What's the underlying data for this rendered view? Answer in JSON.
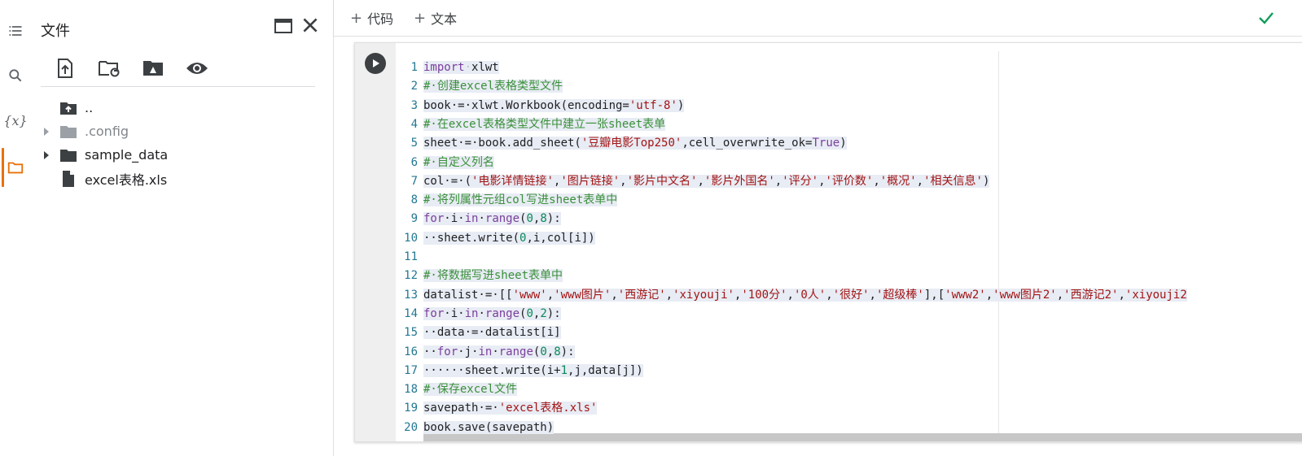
{
  "colors": {
    "accent_orange": "#e8710a",
    "check_green": "#0f9d58",
    "keyword": "#7a3e9d",
    "comment": "#3a8f3a",
    "string": "#a31515",
    "number": "#09885a",
    "line_number": "#237893"
  },
  "rail": {
    "items": [
      {
        "icon": "list-icon"
      },
      {
        "icon": "search-icon"
      },
      {
        "icon": "variables-icon",
        "label": "{x}"
      },
      {
        "icon": "folder-icon",
        "active": true
      }
    ]
  },
  "panel": {
    "title": "文件",
    "tools": [
      "upload-icon",
      "refresh-folder-icon",
      "drive-icon",
      "eye-icon"
    ],
    "tree": [
      {
        "name": "..",
        "type": "parent",
        "caret": false
      },
      {
        "name": ".config",
        "type": "folder",
        "caret": true,
        "muted": true
      },
      {
        "name": "sample_data",
        "type": "folder",
        "caret": true
      },
      {
        "name": "excel表格.xls",
        "type": "file",
        "caret": false
      }
    ]
  },
  "topbar": {
    "add_code": "代码",
    "add_text": "文本"
  },
  "code_lines": [
    {
      "n": "1",
      "segs": [
        [
          "k",
          "import"
        ],
        [
          "p",
          "·"
        ],
        [
          "t",
          "xlwt"
        ]
      ]
    },
    {
      "n": "2",
      "segs": [
        [
          "c",
          "#·创建excel表格类型文件"
        ]
      ]
    },
    {
      "n": "3",
      "segs": [
        [
          "t",
          "book·=·xlwt.Workbook(encoding="
        ],
        [
          "s",
          "'utf-8'"
        ],
        [
          "t",
          ")"
        ]
      ]
    },
    {
      "n": "4",
      "segs": [
        [
          "c",
          "#·在excel表格类型文件中建立一张sheet表单"
        ]
      ]
    },
    {
      "n": "5",
      "segs": [
        [
          "t",
          "sheet·=·book.add_sheet("
        ],
        [
          "s",
          "'豆瓣电影Top250'"
        ],
        [
          "t",
          ",cell_overwrite_ok="
        ],
        [
          "k",
          "True"
        ],
        [
          "t",
          ")"
        ]
      ]
    },
    {
      "n": "6",
      "segs": [
        [
          "c",
          "#·自定义列名"
        ]
      ]
    },
    {
      "n": "7",
      "segs": [
        [
          "t",
          "col·=·("
        ],
        [
          "s",
          "'电影详情链接'"
        ],
        [
          "t",
          ","
        ],
        [
          "s",
          "'图片链接'"
        ],
        [
          "t",
          ","
        ],
        [
          "s",
          "'影片中文名'"
        ],
        [
          "t",
          ","
        ],
        [
          "s",
          "'影片外国名'"
        ],
        [
          "t",
          ","
        ],
        [
          "s",
          "'评分'"
        ],
        [
          "t",
          ","
        ],
        [
          "s",
          "'评价数'"
        ],
        [
          "t",
          ","
        ],
        [
          "s",
          "'概况'"
        ],
        [
          "t",
          ","
        ],
        [
          "s",
          "'相关信息'"
        ],
        [
          "t",
          ")"
        ]
      ]
    },
    {
      "n": "8",
      "segs": [
        [
          "c",
          "#·将列属性元组col写进sheet表单中"
        ]
      ]
    },
    {
      "n": "9",
      "segs": [
        [
          "k",
          "for"
        ],
        [
          "t",
          "·i·"
        ],
        [
          "k",
          "in"
        ],
        [
          "t",
          "·"
        ],
        [
          "k",
          "range"
        ],
        [
          "t",
          "("
        ],
        [
          "m",
          "0"
        ],
        [
          "t",
          ","
        ],
        [
          "m",
          "8"
        ],
        [
          "t",
          "):"
        ]
      ]
    },
    {
      "n": "10",
      "segs": [
        [
          "t",
          "··sheet.write("
        ],
        [
          "m",
          "0"
        ],
        [
          "t",
          ",i,col[i])"
        ]
      ]
    },
    {
      "n": "11",
      "segs": []
    },
    {
      "n": "12",
      "segs": [
        [
          "c",
          "#·将数据写进sheet表单中"
        ]
      ]
    },
    {
      "n": "13",
      "segs": [
        [
          "t",
          "datalist·=·[["
        ],
        [
          "s",
          "'www'"
        ],
        [
          "t",
          ","
        ],
        [
          "s",
          "'www图片'"
        ],
        [
          "t",
          ","
        ],
        [
          "s",
          "'西游记'"
        ],
        [
          "t",
          ","
        ],
        [
          "s",
          "'xiyouji'"
        ],
        [
          "t",
          ","
        ],
        [
          "s",
          "'100分'"
        ],
        [
          "t",
          ","
        ],
        [
          "s",
          "'0人'"
        ],
        [
          "t",
          ","
        ],
        [
          "s",
          "'很好'"
        ],
        [
          "t",
          ","
        ],
        [
          "s",
          "'超级棒'"
        ],
        [
          "t",
          "],["
        ],
        [
          "s",
          "'www2'"
        ],
        [
          "t",
          ","
        ],
        [
          "s",
          "'www图片2'"
        ],
        [
          "t",
          ","
        ],
        [
          "s",
          "'西游记2'"
        ],
        [
          "t",
          ","
        ],
        [
          "s",
          "'xiyouji2"
        ]
      ]
    },
    {
      "n": "14",
      "segs": [
        [
          "k",
          "for"
        ],
        [
          "t",
          "·i·"
        ],
        [
          "k",
          "in"
        ],
        [
          "t",
          "·"
        ],
        [
          "k",
          "range"
        ],
        [
          "t",
          "("
        ],
        [
          "m",
          "0"
        ],
        [
          "t",
          ","
        ],
        [
          "m",
          "2"
        ],
        [
          "t",
          "):"
        ]
      ]
    },
    {
      "n": "15",
      "segs": [
        [
          "t",
          "··data·=·datalist[i]"
        ]
      ]
    },
    {
      "n": "16",
      "segs": [
        [
          "t",
          "··"
        ],
        [
          "k",
          "for"
        ],
        [
          "t",
          "·j·"
        ],
        [
          "k",
          "in"
        ],
        [
          "t",
          "·"
        ],
        [
          "k",
          "range"
        ],
        [
          "t",
          "("
        ],
        [
          "m",
          "0"
        ],
        [
          "t",
          ","
        ],
        [
          "m",
          "8"
        ],
        [
          "t",
          "):"
        ]
      ]
    },
    {
      "n": "17",
      "segs": [
        [
          "t",
          "······sheet.write(i+"
        ],
        [
          "m",
          "1"
        ],
        [
          "t",
          ",j,data[j])"
        ]
      ]
    },
    {
      "n": "18",
      "segs": [
        [
          "c",
          "#·保存excel文件"
        ]
      ]
    },
    {
      "n": "19",
      "segs": [
        [
          "t",
          "savepath·=·"
        ],
        [
          "s",
          "'excel表格.xls'"
        ]
      ]
    },
    {
      "n": "20",
      "segs": [
        [
          "t",
          "book.save(savepath)"
        ]
      ]
    }
  ]
}
